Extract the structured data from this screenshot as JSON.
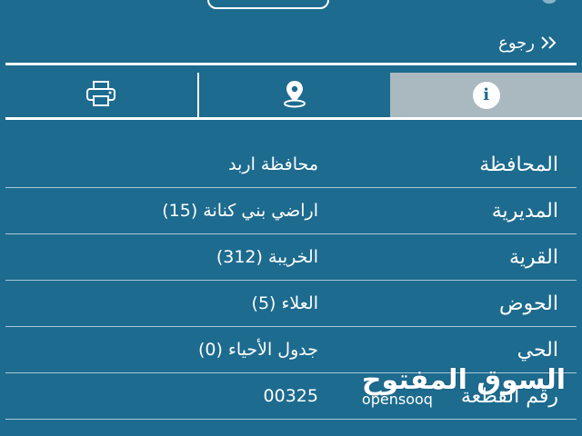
{
  "header": {
    "back_label": "رجوع"
  },
  "tabs": [
    {
      "icon": "printer-icon"
    },
    {
      "icon": "map-pin-icon"
    },
    {
      "icon": "info-icon",
      "glyph": "i",
      "active": true
    }
  ],
  "details": [
    {
      "label": "المحافظة",
      "value": "محافظة اربد"
    },
    {
      "label": "المديرية",
      "value": "اراضي بني كنانة (15)"
    },
    {
      "label": "القرية",
      "value": "الخريبة (312)"
    },
    {
      "label": "الحوض",
      "value": "العلاء (5)"
    },
    {
      "label": "الحي",
      "value": "جدول الأحياء (0)"
    },
    {
      "label": "رقم القطعة",
      "value": "00325"
    }
  ],
  "watermark": {
    "arabic": "السوق المفتوح",
    "latin": "opensooq"
  },
  "colors": {
    "background": "#1d6b8f",
    "active_tab": "#aab8c0",
    "text": "#ffffff"
  }
}
